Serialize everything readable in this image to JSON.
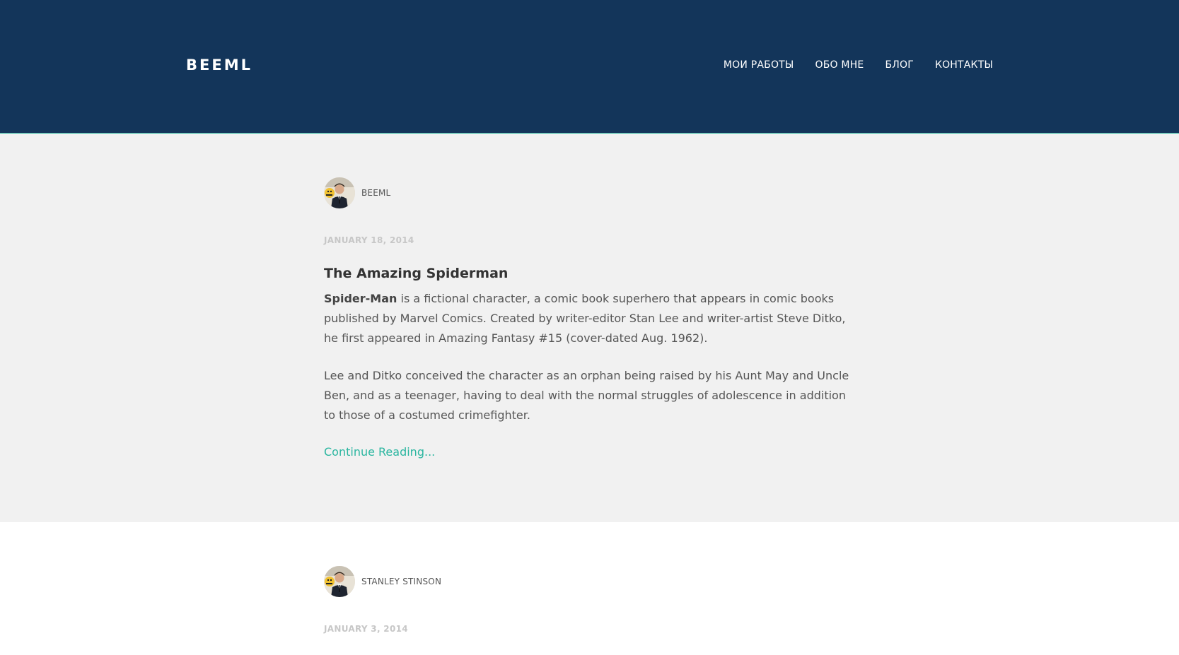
{
  "header": {
    "brand": "BEEML",
    "nav": [
      {
        "label": "МОИ РАБОТЫ"
      },
      {
        "label": "ОБО МНЕ"
      },
      {
        "label": "БЛОГ"
      },
      {
        "label": "КОНТАКТЫ"
      }
    ],
    "background_color": "#13355a",
    "accent_color": "#2bb6a0"
  },
  "posts": [
    {
      "author": "BEEML",
      "date": "JANUARY 18, 2014",
      "title": "The Amazing Spiderman",
      "excerpt_bold": "Spider-Man",
      "excerpt_p1_rest": " is a fictional character, a comic book superhero that appears in comic books published by Marvel Comics. Created by writer-editor Stan Lee and writer-artist Steve Ditko, he first appeared in Amazing Fantasy #15 (cover-dated Aug. 1962).",
      "excerpt_p2": "Lee and Ditko conceived the character as an orphan being raised by his Aunt May and Uncle Ben, and as a teenager, having to deal with the normal struggles of adolescence in addition to those of a costumed crimefighter.",
      "continue_label": "Continue Reading..."
    },
    {
      "author": "STANLEY STINSON",
      "date": "JANUARY 3, 2014"
    }
  ]
}
